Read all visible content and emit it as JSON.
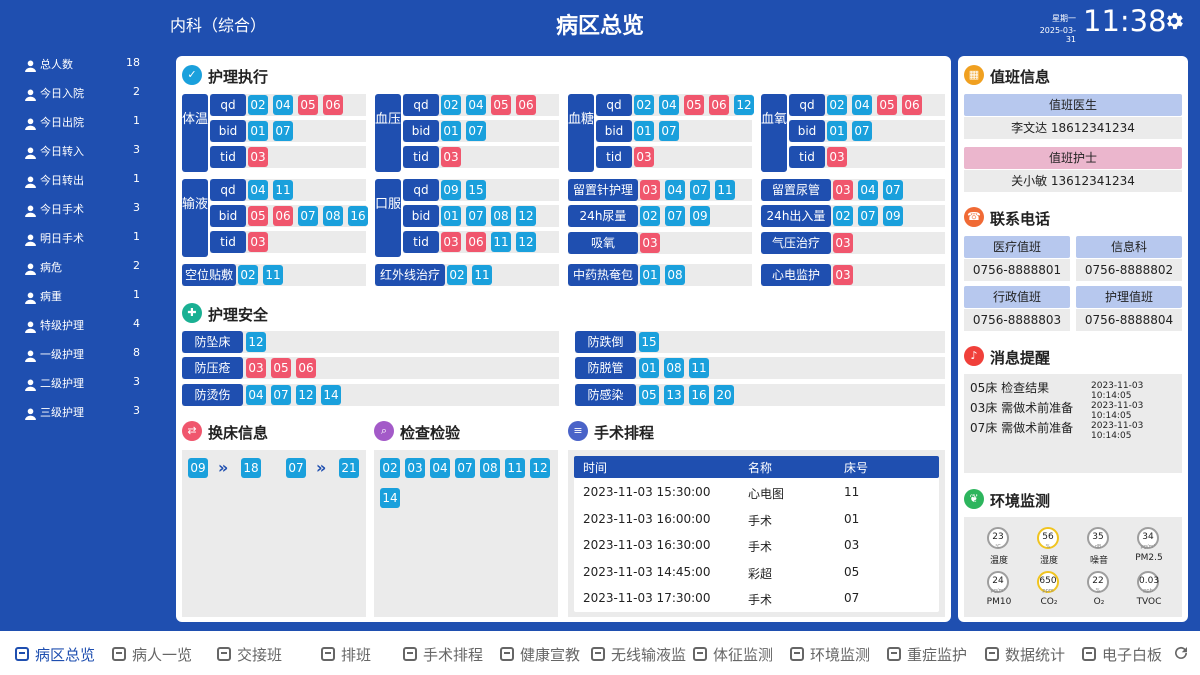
{
  "header": {
    "department": "内科（综合）",
    "title": "病区总览",
    "weekday": "星期一",
    "date": "2025-03-31",
    "time": "11:38"
  },
  "sidebar": [
    {
      "label": "总人数",
      "count": "18",
      "icon": "people-icon"
    },
    {
      "label": "今日入院",
      "count": "2",
      "icon": "admit-icon"
    },
    {
      "label": "今日出院",
      "count": "1",
      "icon": "discharge-icon"
    },
    {
      "label": "今日转入",
      "count": "3",
      "icon": "transfer-in-icon"
    },
    {
      "label": "今日转出",
      "count": "1",
      "icon": "transfer-out-icon"
    },
    {
      "label": "今日手术",
      "count": "3",
      "icon": "surgery-icon"
    },
    {
      "label": "明日手术",
      "count": "1",
      "icon": "scalpel-icon"
    },
    {
      "label": "病危",
      "count": "2",
      "icon": "critical-icon"
    },
    {
      "label": "病重",
      "count": "1",
      "icon": "monitor-icon"
    },
    {
      "label": "特级护理",
      "count": "4",
      "icon": "special-care-icon"
    },
    {
      "label": "一级护理",
      "count": "8",
      "icon": "level1-care-icon"
    },
    {
      "label": "二级护理",
      "count": "3",
      "icon": "pill-icon"
    },
    {
      "label": "三级护理",
      "count": "3",
      "icon": "clover-icon"
    }
  ],
  "nursing_exec": {
    "title": "护理执行",
    "groups": [
      {
        "label": "体温",
        "rows": [
          {
            "freq": "qd",
            "beds": [
              [
                "02",
                "b"
              ],
              [
                "04",
                "b"
              ],
              [
                "05",
                "r"
              ],
              [
                "06",
                "r"
              ]
            ]
          },
          {
            "freq": "bid",
            "beds": [
              [
                "01",
                "b"
              ],
              [
                "07",
                "b"
              ]
            ]
          },
          {
            "freq": "tid",
            "beds": [
              [
                "03",
                "r"
              ]
            ]
          }
        ]
      },
      {
        "label": "血压",
        "rows": [
          {
            "freq": "qd",
            "beds": [
              [
                "02",
                "b"
              ],
              [
                "04",
                "b"
              ],
              [
                "05",
                "r"
              ],
              [
                "06",
                "r"
              ]
            ]
          },
          {
            "freq": "bid",
            "beds": [
              [
                "01",
                "b"
              ],
              [
                "07",
                "b"
              ]
            ]
          },
          {
            "freq": "tid",
            "beds": [
              [
                "03",
                "r"
              ]
            ]
          }
        ]
      },
      {
        "label": "血糖",
        "rows": [
          {
            "freq": "qd",
            "beds": [
              [
                "02",
                "b"
              ],
              [
                "04",
                "b"
              ],
              [
                "05",
                "r"
              ],
              [
                "06",
                "r"
              ],
              [
                "12",
                "b"
              ]
            ]
          },
          {
            "freq": "bid",
            "beds": [
              [
                "01",
                "b"
              ],
              [
                "07",
                "b"
              ]
            ]
          },
          {
            "freq": "tid",
            "beds": [
              [
                "03",
                "r"
              ]
            ]
          }
        ]
      },
      {
        "label": "血氧",
        "rows": [
          {
            "freq": "qd",
            "beds": [
              [
                "02",
                "b"
              ],
              [
                "04",
                "b"
              ],
              [
                "05",
                "r"
              ],
              [
                "06",
                "r"
              ]
            ]
          },
          {
            "freq": "bid",
            "beds": [
              [
                "01",
                "b"
              ],
              [
                "07",
                "b"
              ]
            ]
          },
          {
            "freq": "tid",
            "beds": [
              [
                "03",
                "r"
              ]
            ]
          }
        ]
      },
      {
        "label": "输液",
        "rows": [
          {
            "freq": "qd",
            "beds": [
              [
                "04",
                "b"
              ],
              [
                "11",
                "b"
              ]
            ]
          },
          {
            "freq": "bid",
            "beds": [
              [
                "05",
                "r"
              ],
              [
                "06",
                "r"
              ],
              [
                "07",
                "b"
              ],
              [
                "08",
                "b"
              ],
              [
                "16",
                "b"
              ]
            ]
          },
          {
            "freq": "tid",
            "beds": [
              [
                "03",
                "r"
              ]
            ]
          }
        ]
      },
      {
        "label": "口服",
        "rows": [
          {
            "freq": "qd",
            "beds": [
              [
                "09",
                "b"
              ],
              [
                "15",
                "b"
              ]
            ]
          },
          {
            "freq": "bid",
            "beds": [
              [
                "01",
                "b"
              ],
              [
                "07",
                "b"
              ],
              [
                "08",
                "b"
              ],
              [
                "12",
                "b"
              ]
            ]
          },
          {
            "freq": "tid",
            "beds": [
              [
                "03",
                "r"
              ],
              [
                "06",
                "r"
              ],
              [
                "11",
                "b"
              ],
              [
                "12",
                "b"
              ]
            ]
          }
        ]
      }
    ],
    "items": [
      {
        "label": "留置针护理",
        "beds": [
          [
            "03",
            "r"
          ],
          [
            "04",
            "b"
          ],
          [
            "07",
            "b"
          ],
          [
            "11",
            "b"
          ]
        ]
      },
      {
        "label": "24h尿量",
        "beds": [
          [
            "02",
            "b"
          ],
          [
            "07",
            "b"
          ],
          [
            "09",
            "b"
          ]
        ]
      },
      {
        "label": "吸氧",
        "beds": [
          [
            "03",
            "r"
          ]
        ]
      },
      {
        "label": "留置尿管",
        "beds": [
          [
            "03",
            "r"
          ],
          [
            "04",
            "b"
          ],
          [
            "07",
            "b"
          ]
        ]
      },
      {
        "label": "24h出入量",
        "beds": [
          [
            "02",
            "b"
          ],
          [
            "07",
            "b"
          ],
          [
            "09",
            "b"
          ]
        ]
      },
      {
        "label": "气压治疗",
        "beds": [
          [
            "03",
            "r"
          ]
        ]
      },
      {
        "label": "空位贴敷",
        "beds": [
          [
            "02",
            "b"
          ],
          [
            "11",
            "b"
          ]
        ]
      },
      {
        "label": "红外线治疗",
        "beds": [
          [
            "02",
            "b"
          ],
          [
            "11",
            "b"
          ]
        ]
      },
      {
        "label": "中药热奄包",
        "beds": [
          [
            "01",
            "b"
          ],
          [
            "08",
            "b"
          ]
        ]
      },
      {
        "label": "心电监护",
        "beds": [
          [
            "03",
            "r"
          ]
        ]
      }
    ]
  },
  "safety": {
    "title": "护理安全",
    "items": [
      {
        "label": "防坠床",
        "beds": [
          [
            "12",
            "b"
          ]
        ]
      },
      {
        "label": "防压疮",
        "beds": [
          [
            "03",
            "r"
          ],
          [
            "05",
            "r"
          ],
          [
            "06",
            "r"
          ]
        ]
      },
      {
        "label": "防烫伤",
        "beds": [
          [
            "04",
            "b"
          ],
          [
            "07",
            "b"
          ],
          [
            "12",
            "b"
          ],
          [
            "14",
            "b"
          ]
        ]
      },
      {
        "label": "防跌倒",
        "beds": [
          [
            "15",
            "b"
          ]
        ]
      },
      {
        "label": "防脱管",
        "beds": [
          [
            "01",
            "b"
          ],
          [
            "08",
            "b"
          ],
          [
            "11",
            "b"
          ]
        ]
      },
      {
        "label": "防感染",
        "beds": [
          [
            "05",
            "b"
          ],
          [
            "13",
            "b"
          ],
          [
            "16",
            "b"
          ],
          [
            "20",
            "b"
          ]
        ]
      }
    ]
  },
  "bed_change": {
    "title": "换床信息",
    "pairs": [
      {
        "from": "09",
        "to": "18"
      },
      {
        "from": "07",
        "to": "21"
      }
    ]
  },
  "exam": {
    "title": "检查检验",
    "beds": [
      "02",
      "03",
      "04",
      "07",
      "08",
      "11",
      "12",
      "14"
    ]
  },
  "surgery": {
    "title": "手术排程",
    "headers": [
      "时间",
      "名称",
      "床号"
    ],
    "rows": [
      [
        "2023-11-03 15:30:00",
        "心电图",
        "11"
      ],
      [
        "2023-11-03 16:00:00",
        "手术",
        "01"
      ],
      [
        "2023-11-03 16:30:00",
        "手术",
        "03"
      ],
      [
        "2023-11-03 14:45:00",
        "彩超",
        "05"
      ],
      [
        "2023-11-03 17:30:00",
        "手术",
        "07"
      ]
    ]
  },
  "duty": {
    "title": "值班信息",
    "doctor_label": "值班医生",
    "doctor": "李文达  18612341234",
    "nurse_label": "值班护士",
    "nurse": "关小敏  13612341234"
  },
  "contacts": {
    "title": "联系电话",
    "items": [
      {
        "label": "医疗值班",
        "phone": "0756-8888801"
      },
      {
        "label": "信息科",
        "phone": "0756-8888802"
      },
      {
        "label": "行政值班",
        "phone": "0756-8888803"
      },
      {
        "label": "护理值班",
        "phone": "0756-8888804"
      }
    ]
  },
  "messages": {
    "title": "消息提醒",
    "items": [
      {
        "text": "05床 检查结果",
        "time": "2023-11-03 10:14:05"
      },
      {
        "text": "03床 需做术前准备",
        "time": "2023-11-03 10:14:05"
      },
      {
        "text": "07床 需做术前准备",
        "time": "2023-11-03 10:14:05"
      }
    ]
  },
  "environment": {
    "title": "环境监测",
    "items": [
      {
        "value": "23",
        "unit": "℃",
        "label": "温度",
        "color": "#9e9e9e"
      },
      {
        "value": "56",
        "unit": "%",
        "label": "湿度",
        "color": "#f0c420"
      },
      {
        "value": "35",
        "unit": "dB",
        "label": "噪音",
        "color": "#9e9e9e"
      },
      {
        "value": "34",
        "unit": "μg/m³",
        "label": "PM2.5",
        "color": "#9e9e9e"
      },
      {
        "value": "24",
        "unit": "μg/m³",
        "label": "PM10",
        "color": "#9e9e9e"
      },
      {
        "value": "650",
        "unit": "ppm",
        "label": "CO₂",
        "color": "#f0c420"
      },
      {
        "value": "22",
        "unit": "%",
        "label": "O₂",
        "color": "#9e9e9e"
      },
      {
        "value": "0.03",
        "unit": "ppb",
        "label": "TVOC",
        "color": "#9e9e9e"
      }
    ]
  },
  "bottom_tabs": [
    {
      "label": "病区总览",
      "icon": "overview-icon",
      "active": true
    },
    {
      "label": "病人一览",
      "icon": "patient-card-icon"
    },
    {
      "label": "交接班",
      "icon": "handover-icon"
    },
    {
      "label": "排班",
      "icon": "calendar-icon"
    },
    {
      "label": "手术排程",
      "icon": "surgery-schedule-icon"
    },
    {
      "label": "健康宣教",
      "icon": "education-icon"
    },
    {
      "label": "无线输液监",
      "icon": "infusion-icon"
    },
    {
      "label": "体征监测",
      "icon": "vital-signs-icon"
    },
    {
      "label": "环境监测",
      "icon": "environment-icon"
    },
    {
      "label": "重症监护",
      "icon": "icu-monitor-icon"
    },
    {
      "label": "数据统计",
      "icon": "bar-chart-icon"
    },
    {
      "label": "电子白板",
      "icon": "whiteboard-icon"
    }
  ],
  "colors": {
    "primary": "#1f4fb0",
    "chip_blue": "#1aa0dc",
    "chip_red": "#f0566d"
  }
}
